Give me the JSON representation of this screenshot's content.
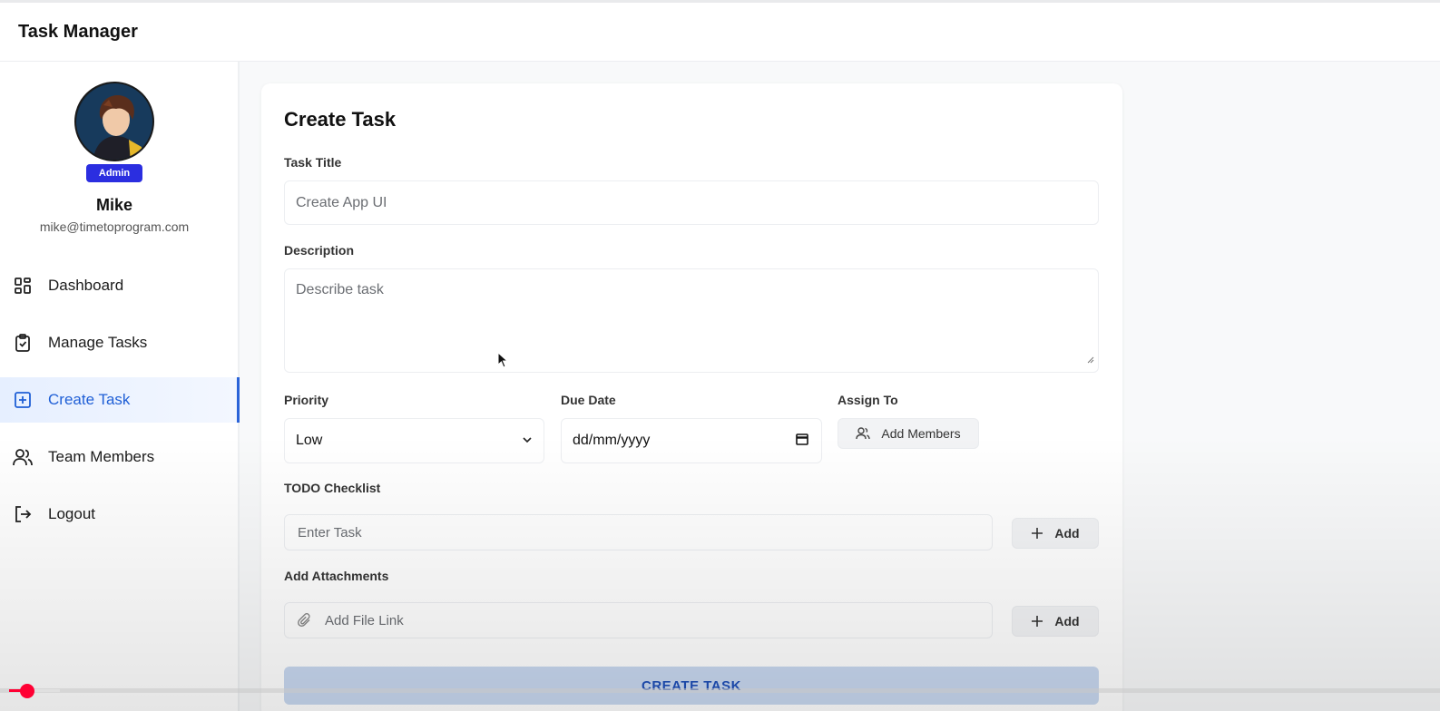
{
  "app": {
    "title": "Task Manager"
  },
  "profile": {
    "role_badge": "Admin",
    "name": "Mike",
    "email": "mike@timetoprogram.com"
  },
  "nav": {
    "items": [
      {
        "label": "Dashboard",
        "icon": "dashboard-icon"
      },
      {
        "label": "Manage Tasks",
        "icon": "clipboard-check-icon"
      },
      {
        "label": "Create Task",
        "icon": "plus-square-icon",
        "active": true
      },
      {
        "label": "Team Members",
        "icon": "users-icon"
      },
      {
        "label": "Logout",
        "icon": "logout-icon"
      }
    ]
  },
  "form": {
    "heading": "Create Task",
    "task_title": {
      "label": "Task Title",
      "placeholder": "Create App UI"
    },
    "description": {
      "label": "Description",
      "placeholder": "Describe task"
    },
    "priority": {
      "label": "Priority",
      "value": "Low"
    },
    "due_date": {
      "label": "Due Date",
      "placeholder": "dd/mm/yyyy"
    },
    "assign_to": {
      "label": "Assign To",
      "button": "Add Members"
    },
    "todo": {
      "label": "TODO Checklist",
      "placeholder": "Enter Task",
      "add": "Add"
    },
    "attachments": {
      "label": "Add Attachments",
      "placeholder": "Add File Link",
      "add": "Add"
    },
    "submit": "CREATE TASK"
  },
  "colors": {
    "accent": "#2a63d8",
    "badge": "#2b2ee0",
    "video_progress": "#ff0033"
  }
}
